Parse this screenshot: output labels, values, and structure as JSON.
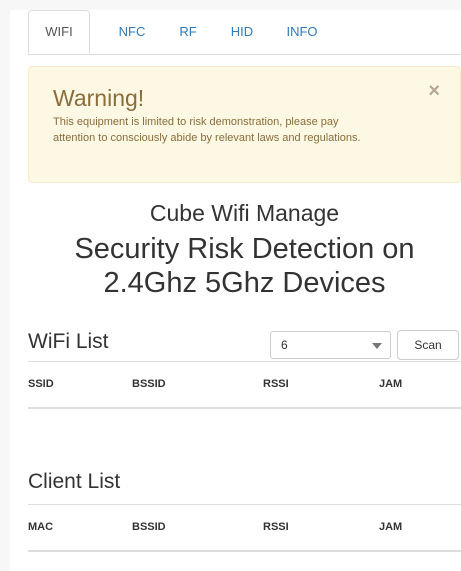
{
  "tabs": [
    {
      "label": "WIFI",
      "active": true
    },
    {
      "label": "NFC",
      "active": false
    },
    {
      "label": "RF",
      "active": false
    },
    {
      "label": "HID",
      "active": false
    },
    {
      "label": "INFO",
      "active": false
    }
  ],
  "alert": {
    "title": "Warning!",
    "text": "This equipment is limited to risk demonstration, please pay attention to consciously abide by relevant laws and regulations.",
    "close": "×"
  },
  "heading": {
    "subtitle": "Cube Wifi Manage",
    "title_line1": "Security Risk Detection on",
    "title_line2": "2.4Ghz 5Ghz Devices"
  },
  "wifi_list": {
    "title": "WiFi List",
    "channel_value": "6",
    "scan_label": "Scan",
    "columns": [
      "SSID",
      "BSSID",
      "RSSI",
      "JAM"
    ]
  },
  "client_list": {
    "title": "Client List",
    "columns": [
      "MAC",
      "BSSID",
      "RSSI",
      "JAM"
    ]
  },
  "colors": {
    "link": "#337ab7",
    "alert_bg": "#fcf8e3",
    "alert_text": "#8a6d3b"
  }
}
